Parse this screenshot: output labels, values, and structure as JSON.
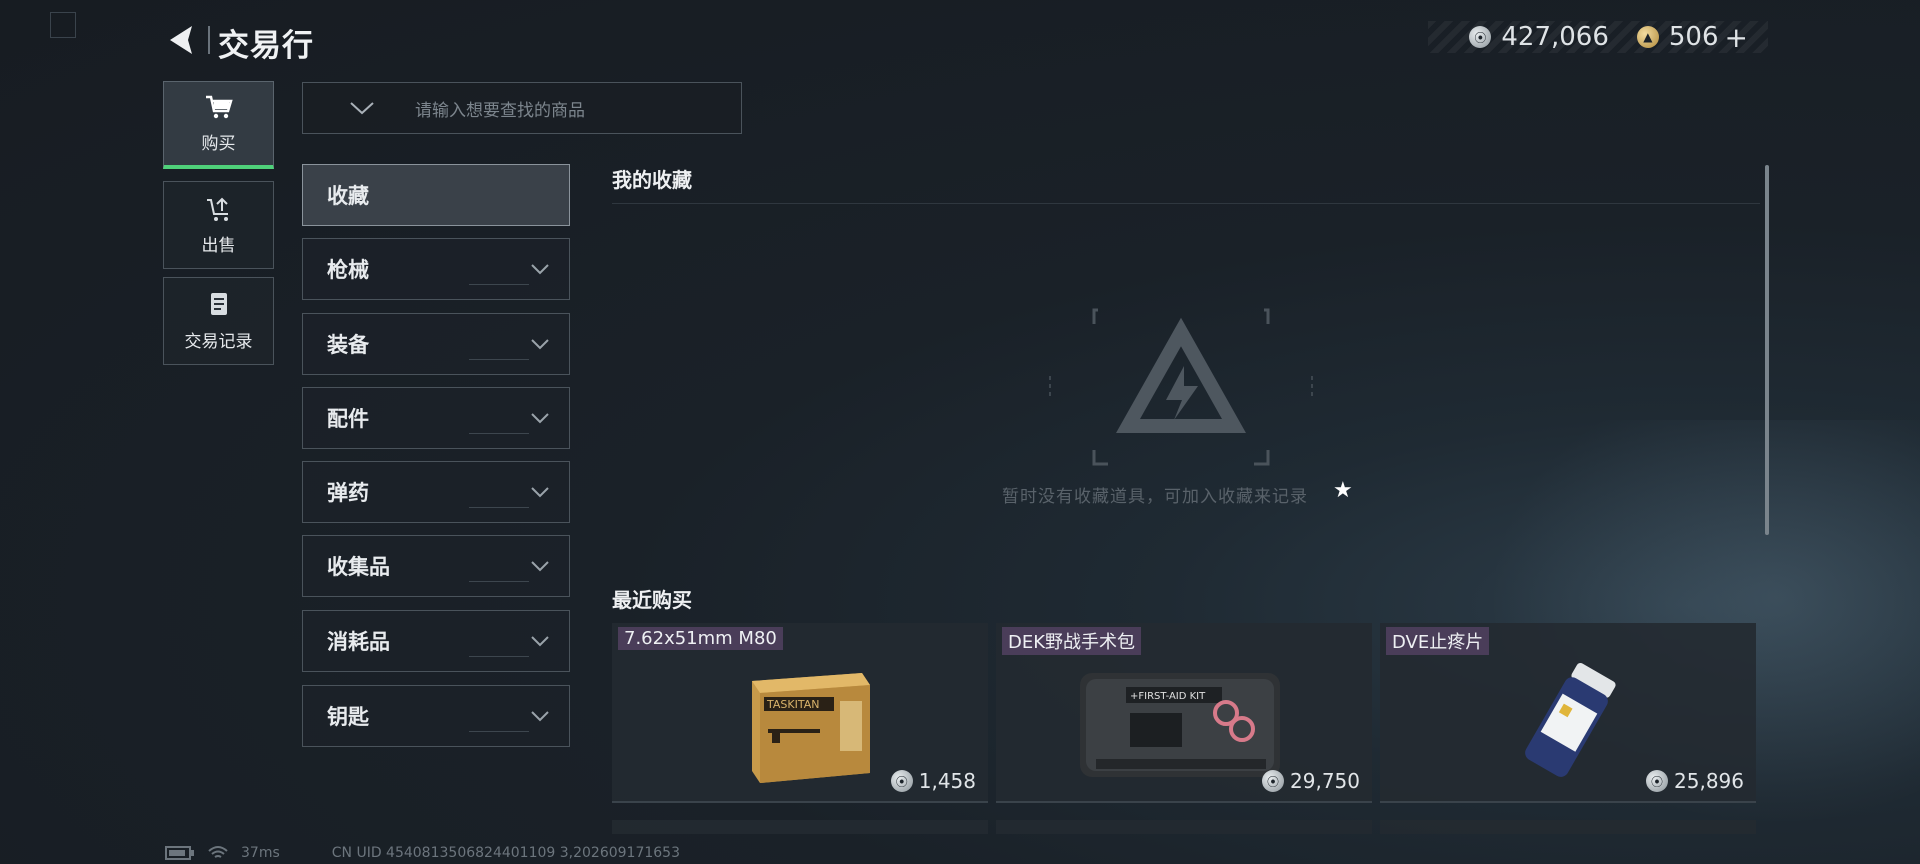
{
  "header": {
    "title": "交易行",
    "silver_amount": "427,066",
    "gold_amount": "506",
    "add_symbol": "+"
  },
  "nav": {
    "items": [
      {
        "label": "购买",
        "icon": "cart-icon",
        "active": true
      },
      {
        "label": "出售",
        "icon": "sell-icon",
        "active": false
      },
      {
        "label": "交易记录",
        "icon": "records-icon",
        "active": false
      }
    ]
  },
  "search": {
    "placeholder": "请输入想要查找的商品"
  },
  "categories": [
    {
      "label": "收藏",
      "active": true
    },
    {
      "label": "枪械"
    },
    {
      "label": "装备"
    },
    {
      "label": "配件"
    },
    {
      "label": "弹药"
    },
    {
      "label": "收集品"
    },
    {
      "label": "消耗品"
    },
    {
      "label": "钥匙"
    }
  ],
  "favorites": {
    "title": "我的收藏",
    "empty_text": "暂时没有收藏道具，可加入收藏来记录",
    "star": "★"
  },
  "recent": {
    "title": "最近购买",
    "items": [
      {
        "name": "7.62x51mm M80",
        "price": "1,458",
        "icon": "ammo-box-icon"
      },
      {
        "name": "DEK野战手术包",
        "price": "29,750",
        "icon": "first-aid-kit-icon"
      },
      {
        "name": "DVE止疼片",
        "price": "25,896",
        "icon": "pill-bottle-icon"
      }
    ]
  },
  "status_bar": {
    "ping": "37ms",
    "uid": "CN UID 4540813506824401109 3,202609171653"
  },
  "colors": {
    "accent_green": "#4fd17a",
    "item_name_bg": "#4a3d59"
  }
}
